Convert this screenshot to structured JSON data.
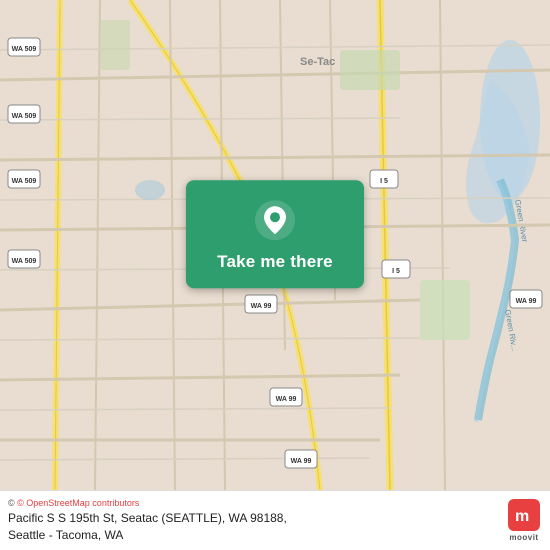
{
  "map": {
    "background_color": "#e8ddd0",
    "cta_button": {
      "label": "Take me there",
      "background_color": "#2e9e6e"
    }
  },
  "footer": {
    "attribution_text": "© OpenStreetMap contributors",
    "address_line1": "Pacific S S 195th St, Seatac (SEATTLE), WA 98188,",
    "address_line2": "Seattle - Tacoma, WA",
    "moovit_label": "moovit"
  },
  "icons": {
    "location_pin": "location-pin-icon",
    "moovit_logo": "moovit-logo-icon"
  }
}
